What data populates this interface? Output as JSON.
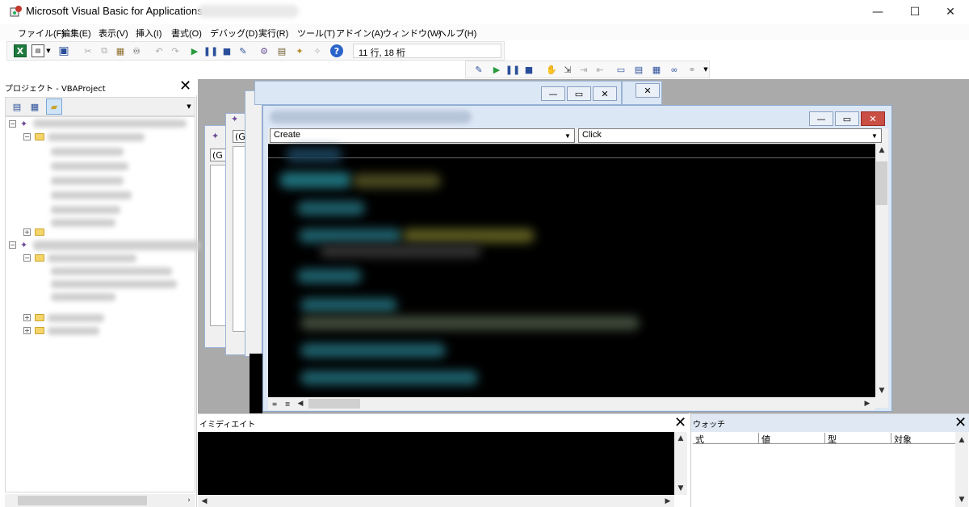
{
  "window": {
    "title": "Microsoft Visual Basic for Applications",
    "minimize_glyph": "—",
    "maximize_glyph": "☐",
    "close_glyph": "✕"
  },
  "menu": [
    "ファイル(F)",
    "編集(E)",
    "表示(V)",
    "挿入(I)",
    "書式(O)",
    "デバッグ(D)",
    "実行(R)",
    "ツール(T)",
    "アドイン(A)",
    "ウィンドウ(W)",
    "ヘルプ(H)"
  ],
  "toolbar": {
    "cursor_position": "11 行, 18 桁",
    "help_glyph": "?"
  },
  "project": {
    "title": "プロジェクト - VBAProject",
    "close_glyph": "✕"
  },
  "code_window": {
    "object_combo": "Create",
    "procedure_combo": "Click",
    "bg_combo_a": "(G",
    "bg_combo_b": "(G",
    "bg_combo_c": "(G"
  },
  "immediate": {
    "title": "イミディエイト",
    "close_glyph": "✕"
  },
  "watch": {
    "title": "ウォッチ",
    "close_glyph": "✕",
    "columns": [
      "式",
      "値",
      "型",
      "対象"
    ]
  },
  "colors": {
    "code_bg": "#000000",
    "keyword_teal": "#1e6f7a",
    "literal_yellow": "#9a9a20",
    "close_red": "#c94f45"
  }
}
